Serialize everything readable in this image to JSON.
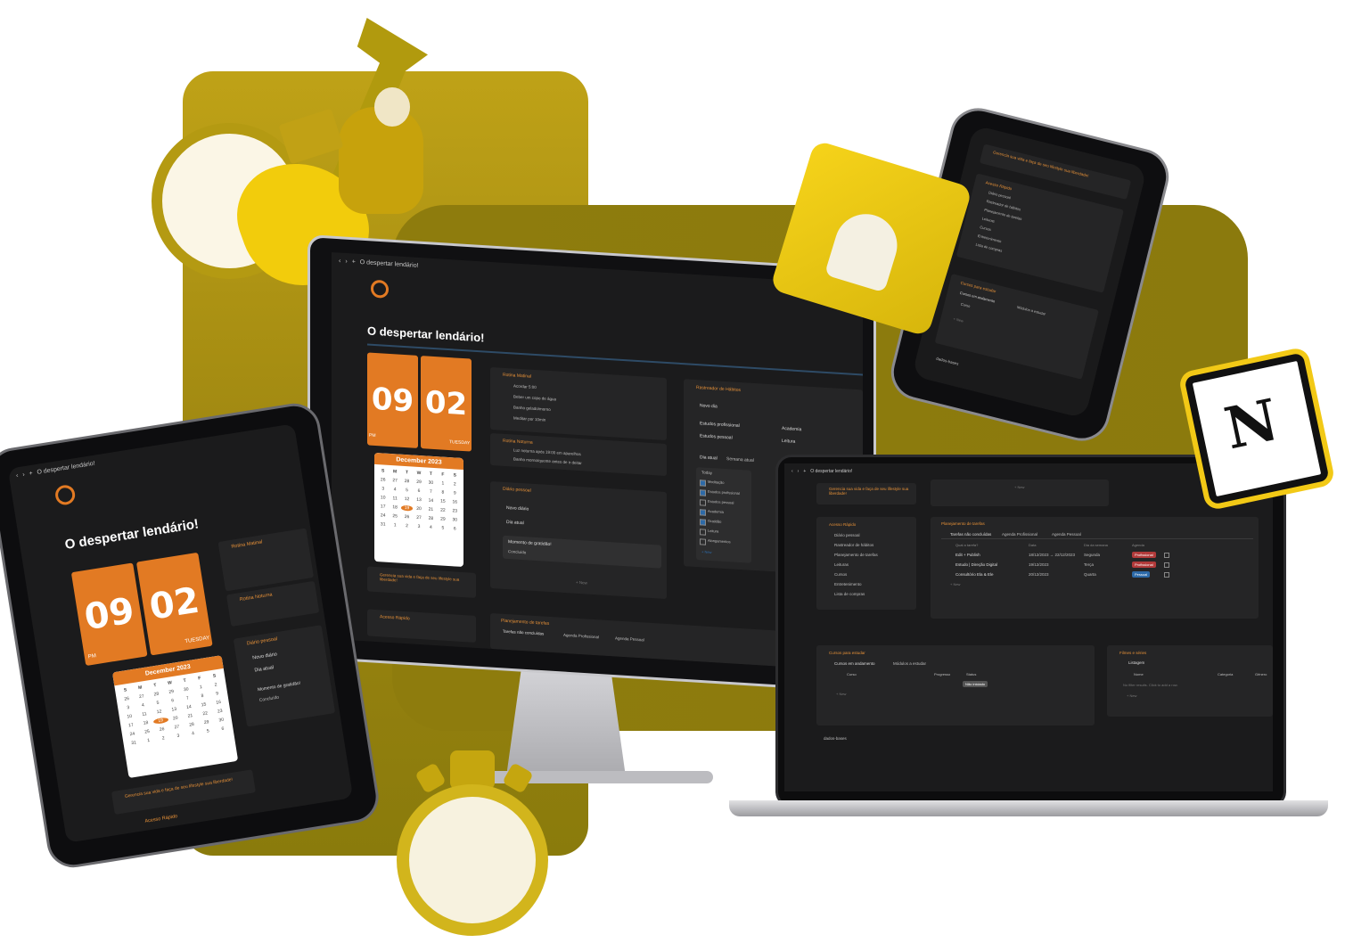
{
  "app_title": "O despertar lendário!",
  "clock": {
    "hour": "09",
    "minute": "02",
    "ampm": "PM",
    "day": "TUESDAY"
  },
  "calendar": {
    "month": "December 2023",
    "weekdays": [
      "S",
      "M",
      "T",
      "W",
      "T",
      "F",
      "S"
    ],
    "days": [
      "26",
      "27",
      "28",
      "29",
      "30",
      "1",
      "2",
      "3",
      "4",
      "5",
      "6",
      "7",
      "8",
      "9",
      "10",
      "11",
      "12",
      "13",
      "14",
      "15",
      "16",
      "17",
      "18",
      "19",
      "20",
      "21",
      "22",
      "23",
      "24",
      "25",
      "26",
      "27",
      "28",
      "29",
      "30",
      "31",
      "1",
      "2",
      "3",
      "4",
      "5",
      "6"
    ],
    "selected": "19"
  },
  "morning": {
    "title": "Rotina Matinal",
    "items": [
      "Acordar 5:00",
      "Beber um copo de água",
      "Banho gelado/morno",
      "Meditar por 10min"
    ]
  },
  "night": {
    "title": "Rotina Noturna",
    "items": [
      "Luz noturna após 19:00 em aparelhos",
      "Banho morno/quente antes de ir deitar"
    ]
  },
  "diary": {
    "title": "Diário pessoal",
    "new": "Novo diário",
    "today": "Dia atual",
    "entry": "Momento de gratidão!",
    "done": "Concluído",
    "add": "+ New"
  },
  "habits": {
    "title": "Rastreador de Hábitos",
    "new_day": "Novo dia",
    "buttons": [
      "Estudos profissional",
      "Academia",
      "Estudos pessoal",
      "Leitura"
    ],
    "tabs": [
      "Dia atual",
      "Semana atual"
    ],
    "today_label": "Today",
    "checklist": [
      {
        "label": "Meditação",
        "checked": true
      },
      {
        "label": "Estudos profissional",
        "checked": true
      },
      {
        "label": "Estudos pessoal",
        "checked": false
      },
      {
        "label": "Academia",
        "checked": true
      },
      {
        "label": "Gratidão",
        "checked": true
      },
      {
        "label": "Leitura",
        "checked": false
      },
      {
        "label": "Alongamentos",
        "checked": false
      }
    ],
    "more": "+ New"
  },
  "tagline": "Gerencia sua vida e faça de seu lifestyle sua liberdade!",
  "quick_access": {
    "title": "Acesso Rápido",
    "items": [
      "Diário pessoal",
      "Rastreador de hábitos",
      "Planejamento de tarefas",
      "Leituras",
      "Cursos",
      "Entretenimento",
      "Lista de compras"
    ]
  },
  "tasks": {
    "title": "Planejamento de tarefas",
    "tabs": [
      "Tarefas não concluídas",
      "Agenda Profissional",
      "Agenda Pessoal"
    ],
    "headers": [
      "Qual a tarefa?",
      "Data",
      "Dia da semana",
      "Agenda"
    ],
    "rows": [
      {
        "task": "Edit + Publish",
        "date": "18/12/2023 → 22/12/2023",
        "weekday": "Segunda",
        "agenda": "Profissional",
        "agenda_color": "#b23a3a"
      },
      {
        "task": "Estudo | Direção Digital",
        "date": "19/12/2023",
        "weekday": "Terça",
        "agenda": "Profissional",
        "agenda_color": "#b23a3a"
      },
      {
        "task": "Consultório Ela & Ele",
        "date": "20/12/2023",
        "weekday": "Quarta",
        "agenda": "Pessoal",
        "agenda_color": "#2d6aa8"
      }
    ],
    "add": "+ New"
  },
  "courses": {
    "title": "Cursos para estudar",
    "tabs": [
      "Cursos em andamento",
      "Módulos a estudar"
    ],
    "headers": [
      "Curso",
      "Progresso",
      "Status"
    ],
    "status": "Não iniciado",
    "add": "+ New"
  },
  "films": {
    "title": "Filmes e séries",
    "tab": "Listagem",
    "headers": [
      "Nome",
      "Categoria",
      "Gênero"
    ],
    "empty": "No filter results. Click to add a row.",
    "add": "+ New"
  },
  "database": "dados-bases",
  "phone_dbbases": "dados-bases",
  "colors": {
    "accent": "#e27a23",
    "gold": "#bfa217",
    "olive": "#8e7c0d",
    "screen_bg": "#1b1b1c",
    "card_bg": "#252526"
  }
}
